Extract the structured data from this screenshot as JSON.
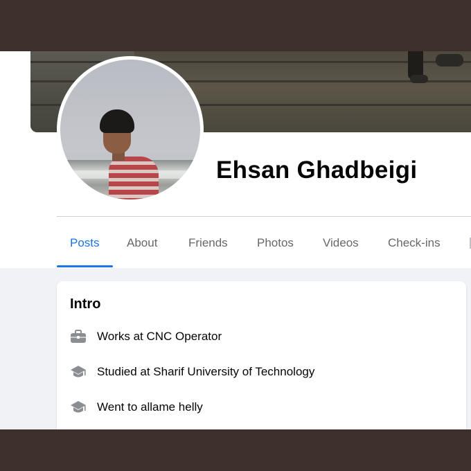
{
  "profile": {
    "name": "Ehsan Ghadbeigi"
  },
  "tabs": [
    {
      "label": "Posts",
      "active": true
    },
    {
      "label": "About",
      "active": false
    },
    {
      "label": "Friends",
      "active": false
    },
    {
      "label": "Photos",
      "active": false
    },
    {
      "label": "Videos",
      "active": false
    },
    {
      "label": "Check-ins",
      "active": false
    }
  ],
  "intro": {
    "title": "Intro",
    "items": [
      {
        "icon": "briefcase-icon",
        "text": "Works at CNC Operator"
      },
      {
        "icon": "graduation-cap-icon",
        "text": "Studied at Sharif University of Technology"
      },
      {
        "icon": "graduation-cap-icon",
        "text": "Went to allame helly"
      }
    ]
  },
  "colors": {
    "accent": "#1b74e4",
    "tab_inactive": "#65676b",
    "page_bg": "#f0f2f5",
    "frame_border": "#3d2f2c"
  }
}
